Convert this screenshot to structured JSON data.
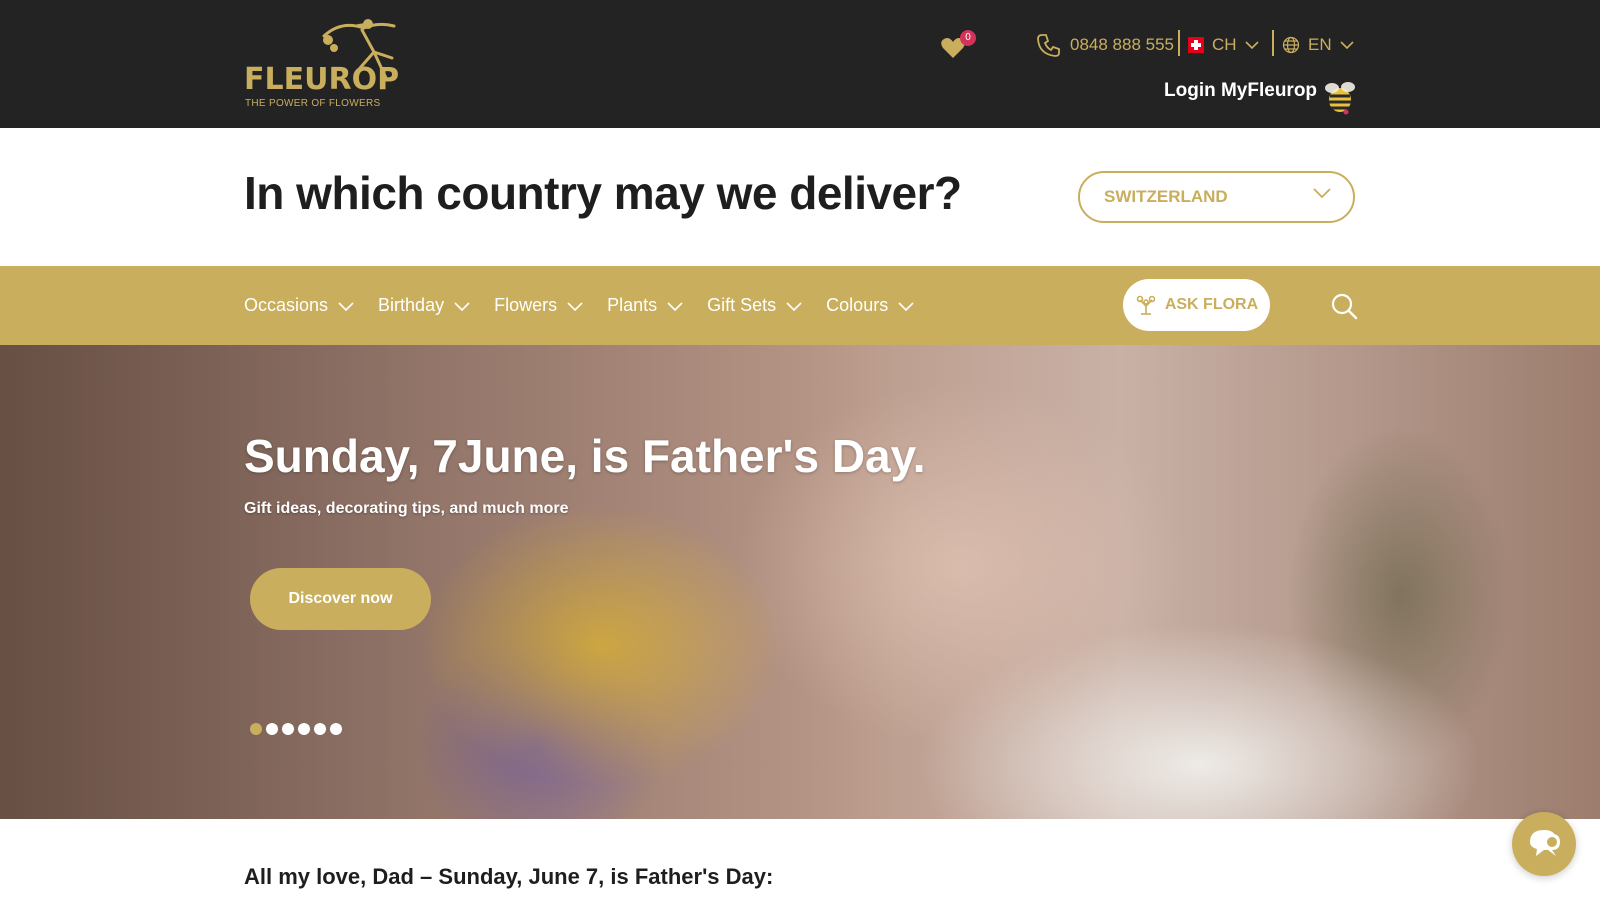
{
  "brand": {
    "name": "FLEUROP",
    "tagline": "THE POWER OF FLOWERS",
    "gold": "#c9ae5d",
    "dark": "#232323"
  },
  "header": {
    "wishlist_count": "0",
    "phone": "0848 888 555",
    "country_code": "CH",
    "language": "EN",
    "login_label": "Login MyFleurop"
  },
  "country_picker": {
    "question": "In which country may we deliver?",
    "selected": "SWITZERLAND"
  },
  "nav": {
    "items": [
      {
        "label": "Occasions"
      },
      {
        "label": "Birthday"
      },
      {
        "label": "Flowers"
      },
      {
        "label": "Plants"
      },
      {
        "label": "Gift Sets"
      },
      {
        "label": "Colours"
      }
    ],
    "ask_flora_label": "ASK FLORA"
  },
  "hero": {
    "title": "Sunday, 7June, is Father's Day.",
    "subtitle": "Gift ideas, decorating tips, and much more",
    "cta_label": "Discover now",
    "slide_count": 6,
    "active_slide": 1
  },
  "content": {
    "intro_heading": "All my love, Dad – Sunday, June 7, is Father's Day:"
  },
  "icons": [
    "heart-icon",
    "phone-icon",
    "swiss-flag-icon",
    "globe-icon",
    "chevron-down-icon",
    "bee-icon",
    "flora-icon",
    "search-icon",
    "chat-icon"
  ]
}
